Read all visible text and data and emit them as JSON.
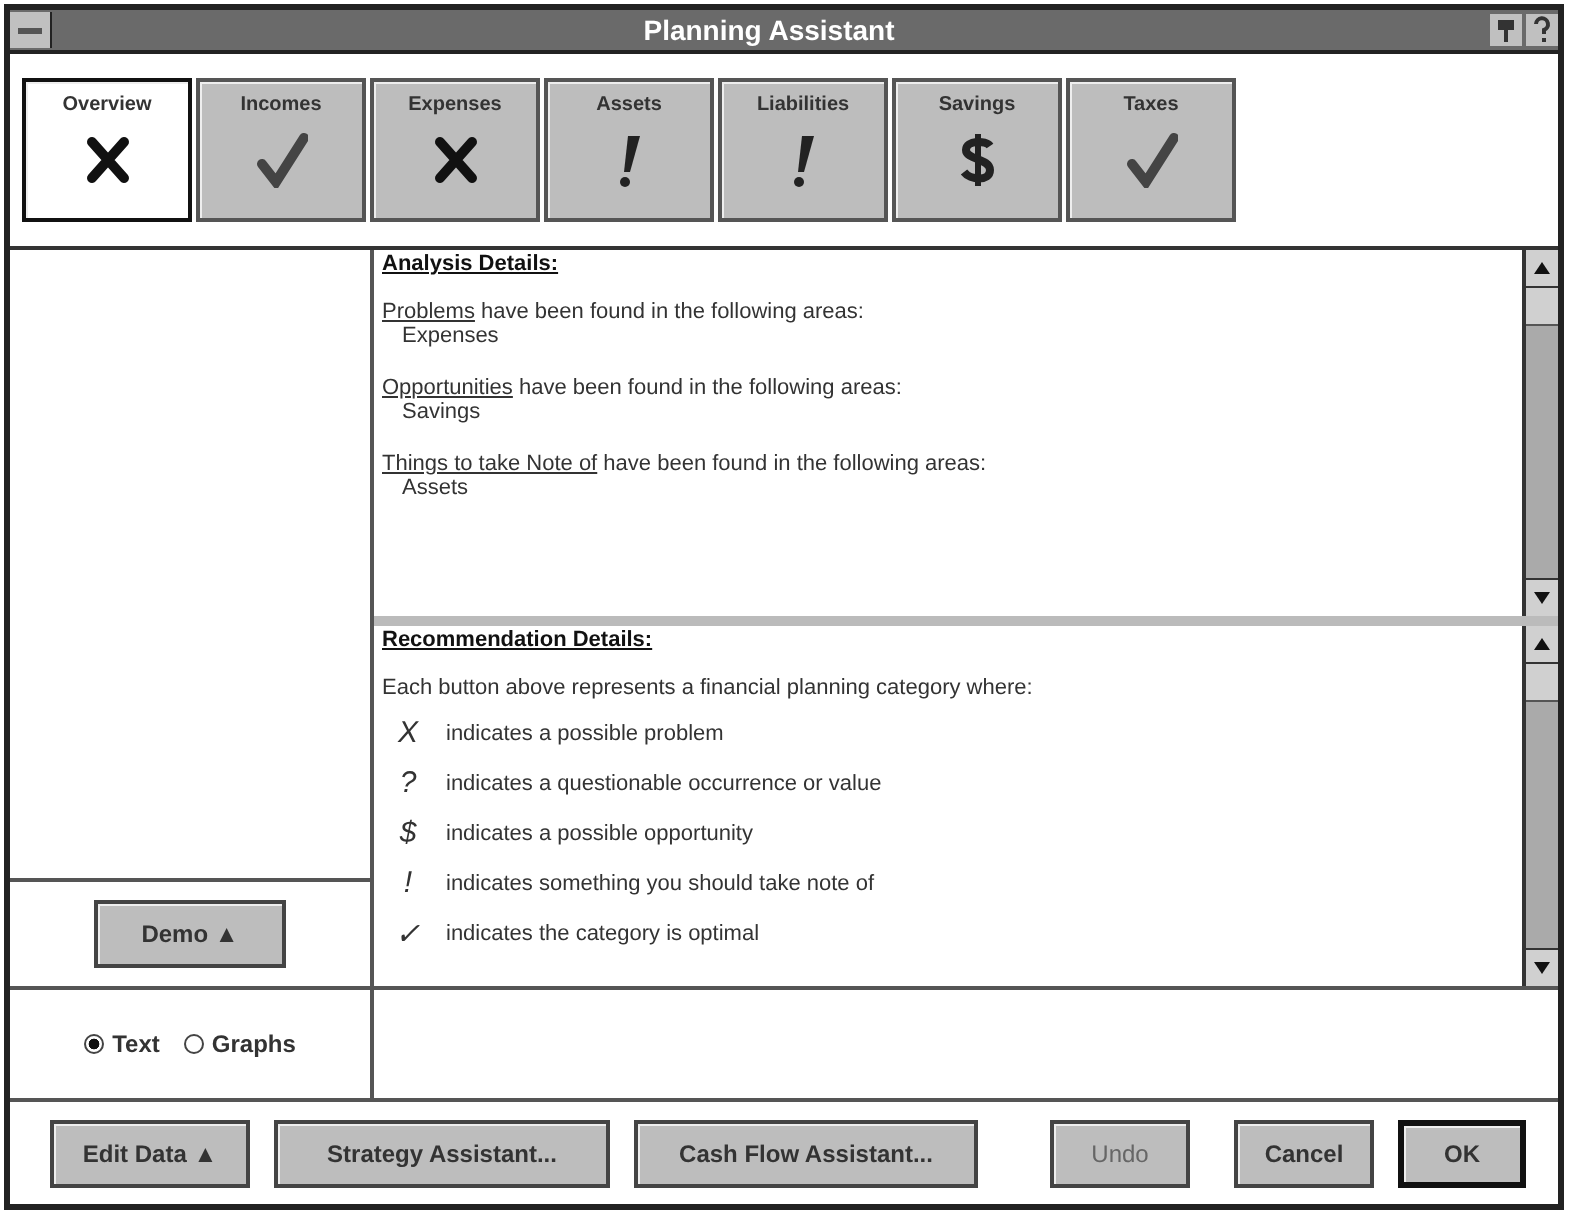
{
  "window": {
    "title": "Planning Assistant"
  },
  "tabs": [
    {
      "label": "Overview",
      "kind": "problem",
      "selected": true
    },
    {
      "label": "Incomes",
      "kind": "optimal",
      "selected": false
    },
    {
      "label": "Expenses",
      "kind": "problem",
      "selected": false
    },
    {
      "label": "Assets",
      "kind": "note",
      "selected": false
    },
    {
      "label": "Liabilities",
      "kind": "note",
      "selected": false
    },
    {
      "label": "Savings",
      "kind": "opportunity",
      "selected": false
    },
    {
      "label": "Taxes",
      "kind": "optimal",
      "selected": false
    }
  ],
  "analysis": {
    "heading": "Analysis Details:",
    "sections": [
      {
        "term": "Problems",
        "text": "have been found in the following areas:",
        "areas": [
          "Expenses"
        ]
      },
      {
        "term": "Opportunities",
        "text": "have been found in the following areas:",
        "areas": [
          "Savings"
        ]
      },
      {
        "term": "Things to take Note of",
        "text": "have been found in the following areas:",
        "areas": [
          "Assets"
        ]
      }
    ]
  },
  "recommendation": {
    "heading": "Recommendation Details:",
    "intro": "Each button above represents a financial planning category where:",
    "legend": [
      {
        "symbol": "X",
        "text": "indicates a possible problem"
      },
      {
        "symbol": "?",
        "text": "indicates a questionable occurrence or value"
      },
      {
        "symbol": "$",
        "text": "indicates a possible opportunity"
      },
      {
        "symbol": "!",
        "text": "indicates something you should take note of"
      },
      {
        "symbol": "✓",
        "text": "indicates the category is optimal"
      }
    ]
  },
  "demo_button": "Demo ▲",
  "view_options": [
    {
      "label": "Text",
      "selected": true
    },
    {
      "label": "Graphs",
      "selected": false
    }
  ],
  "buttons": [
    {
      "label": "Edit Data ▲",
      "disabled": false,
      "default": false
    },
    {
      "label": "Strategy Assistant...",
      "disabled": false,
      "default": false
    },
    {
      "label": "Cash Flow Assistant...",
      "disabled": false,
      "default": false
    },
    {
      "label": "Undo",
      "disabled": true,
      "default": false
    },
    {
      "label": "Cancel",
      "disabled": false,
      "default": false
    },
    {
      "label": "OK",
      "disabled": false,
      "default": true
    }
  ]
}
